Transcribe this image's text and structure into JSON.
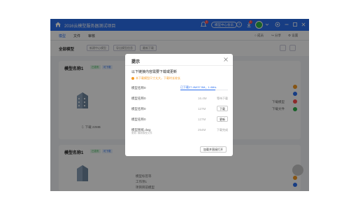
{
  "topbar": {
    "title": "2016云模型服务器测试项目",
    "search_btn": "模型中心会员",
    "notif_count_1": "1",
    "notif_count_2": "1"
  },
  "tabs": [
    "模型",
    "文件",
    "审核"
  ],
  "tab_tools": [
    "成员",
    "分享",
    "设置"
  ],
  "filter": {
    "label": "全部模型",
    "chips": [
      "新建中心模型",
      "导出模型信息",
      "最新下载"
    ]
  },
  "cards": [
    {
      "title": "模型名称1",
      "tags": [
        "已发布",
        "可下载"
      ],
      "download_label": "下载 22MB",
      "right_items": [
        "下载模型",
        "下载文件"
      ]
    },
    {
      "title": "模型名称1",
      "tags": [
        "已发布",
        "可下载"
      ],
      "details": [
        "模型标签等",
        "工作项1",
        "项目目前模型"
      ]
    }
  ],
  "modal": {
    "title": "提示",
    "message": "以下链接内容需要下载或更新",
    "warning": "本下载模型尺寸太大，下载时长较长",
    "rows": [
      {
        "name": "模型名称0",
        "progress_text": "已下载27.4M/37.5M，1.4M/s",
        "progress": 0.73
      },
      {
        "name": "模型名称0",
        "size": "16.4M",
        "action": "等待下载"
      },
      {
        "name": "模型名称0",
        "size": "127M",
        "action": "下载"
      },
      {
        "name": "模型名称0",
        "size": "127M",
        "action": "更新"
      },
      {
        "name": "模型图纸.dwg",
        "sub": "更新: 最新模型文件",
        "size": "254M",
        "action": "下载完成"
      }
    ],
    "open_button": "加载并直接打开"
  },
  "colors": {
    "primary": "#2b6fee",
    "success": "#2fb34c",
    "warning": "#f59a23",
    "danger": "#ff4d4f"
  }
}
